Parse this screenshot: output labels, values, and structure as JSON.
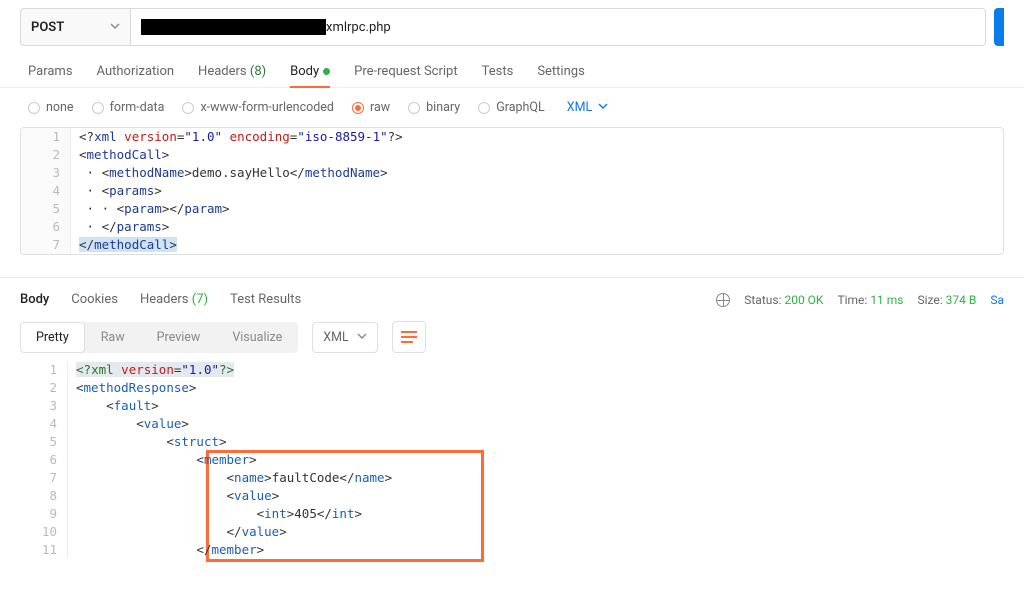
{
  "request": {
    "method": "POST",
    "url_suffix": "xmlrpc.php"
  },
  "tabs": {
    "params": "Params",
    "authorization": "Authorization",
    "headers": "Headers",
    "headers_count": "(8)",
    "body": "Body",
    "prerequest": "Pre-request Script",
    "tests": "Tests",
    "settings": "Settings"
  },
  "body_types": {
    "none": "none",
    "formdata": "form-data",
    "urlencoded": "x-www-form-urlencoded",
    "raw": "raw",
    "binary": "binary",
    "graphql": "GraphQL",
    "format": "XML"
  },
  "request_body": {
    "l1": {
      "pi1": "<?",
      "pi2": "xml ",
      "a1": "version",
      "eq": "=",
      "v1": "\"1.0\"",
      "sp": " ",
      "a2": "encoding",
      "v2": "\"iso-8859-1\"",
      "pi3": "?>"
    },
    "l2": {
      "o": "<",
      "t": "methodCall",
      "c": ">"
    },
    "l3": {
      "o1": "<",
      "t1": "methodName",
      "c1": ">",
      "txt": "demo.sayHello",
      "o2": "</",
      "t2": "methodName",
      "c2": ">"
    },
    "l4": {
      "o": "<",
      "t": "params",
      "c": ">"
    },
    "l5": {
      "o1": "<",
      "t1": "param",
      "c1": ">",
      "o2": "</",
      "t2": "param",
      "c2": ">"
    },
    "l6": {
      "o": "</",
      "t": "params",
      "c": ">"
    },
    "l7": {
      "o": "</",
      "t": "methodCall",
      "c": ">"
    }
  },
  "response_tabs": {
    "body": "Body",
    "cookies": "Cookies",
    "headers": "Headers",
    "headers_count": "(7)",
    "tests": "Test Results"
  },
  "response_meta": {
    "status_label": "Status:",
    "status_value": "200 OK",
    "time_label": "Time:",
    "time_value": "11 ms",
    "size_label": "Size:",
    "size_value": "374 B",
    "save": "Sa"
  },
  "view_modes": {
    "pretty": "Pretty",
    "raw": "Raw",
    "preview": "Preview",
    "visualize": "Visualize",
    "format": "XML"
  },
  "response_body": {
    "l1": {
      "pi1": "<?",
      "pi2": "xml ",
      "a1": "version",
      "eq": "=",
      "v1": "\"1.0\"",
      "pi3": "?>"
    },
    "l2": {
      "o": "<",
      "t": "methodResponse",
      "c": ">"
    },
    "l3": {
      "o": "<",
      "t": "fault",
      "c": ">"
    },
    "l4": {
      "o": "<",
      "t": "value",
      "c": ">"
    },
    "l5": {
      "o": "<",
      "t": "struct",
      "c": ">"
    },
    "l6": {
      "o": "<",
      "t": "member",
      "c": ">"
    },
    "l7": {
      "o1": "<",
      "t1": "name",
      "c1": ">",
      "txt": "faultCode",
      "o2": "</",
      "t2": "name",
      "c2": ">"
    },
    "l8": {
      "o": "<",
      "t": "value",
      "c": ">"
    },
    "l9": {
      "o1": "<",
      "t1": "int",
      "c1": ">",
      "txt": "405",
      "o2": "</",
      "t2": "int",
      "c2": ">"
    },
    "l10": {
      "o": "</",
      "t": "value",
      "c": ">"
    },
    "l11": {
      "o": "</",
      "t": "member",
      "c": ">"
    }
  },
  "nums": {
    "n1": "1",
    "n2": "2",
    "n3": "3",
    "n4": "4",
    "n5": "5",
    "n6": "6",
    "n7": "7",
    "n8": "8",
    "n9": "9",
    "n10": "10",
    "n11": "11"
  }
}
